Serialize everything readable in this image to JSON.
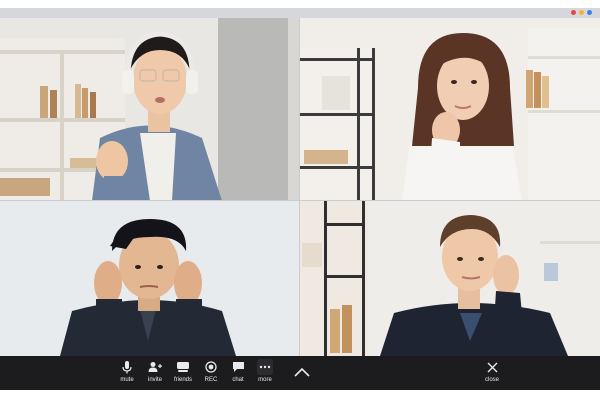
{
  "window": {
    "dots": [
      {
        "name": "red-dot",
        "color": "#e8483f"
      },
      {
        "name": "yellow-dot",
        "color": "#f2b431"
      },
      {
        "name": "blue-dot",
        "color": "#3b82e8"
      }
    ]
  },
  "participants": [
    {
      "name": "participant-1"
    },
    {
      "name": "participant-2"
    },
    {
      "name": "participant-3"
    },
    {
      "name": "participant-4"
    }
  ],
  "toolbar": {
    "mute": {
      "label": "mute",
      "icon": "microphone-icon"
    },
    "invite": {
      "label": "invite",
      "icon": "add-user-icon"
    },
    "friends": {
      "label": "friends",
      "icon": "friends-icon"
    },
    "rec": {
      "label": "REC",
      "icon": "record-icon"
    },
    "chat": {
      "label": "chat",
      "icon": "chat-bubble-icon"
    },
    "more": {
      "label": "more",
      "icon": "more-dots-icon"
    },
    "expand": {
      "icon": "chevron-up-icon"
    },
    "close": {
      "label": "close",
      "icon": "close-icon"
    }
  },
  "colors": {
    "toolbar_bg": "#1c1c1e",
    "toolbar_fg": "#e9e9ee",
    "window_bar": "#d6d7dc"
  }
}
